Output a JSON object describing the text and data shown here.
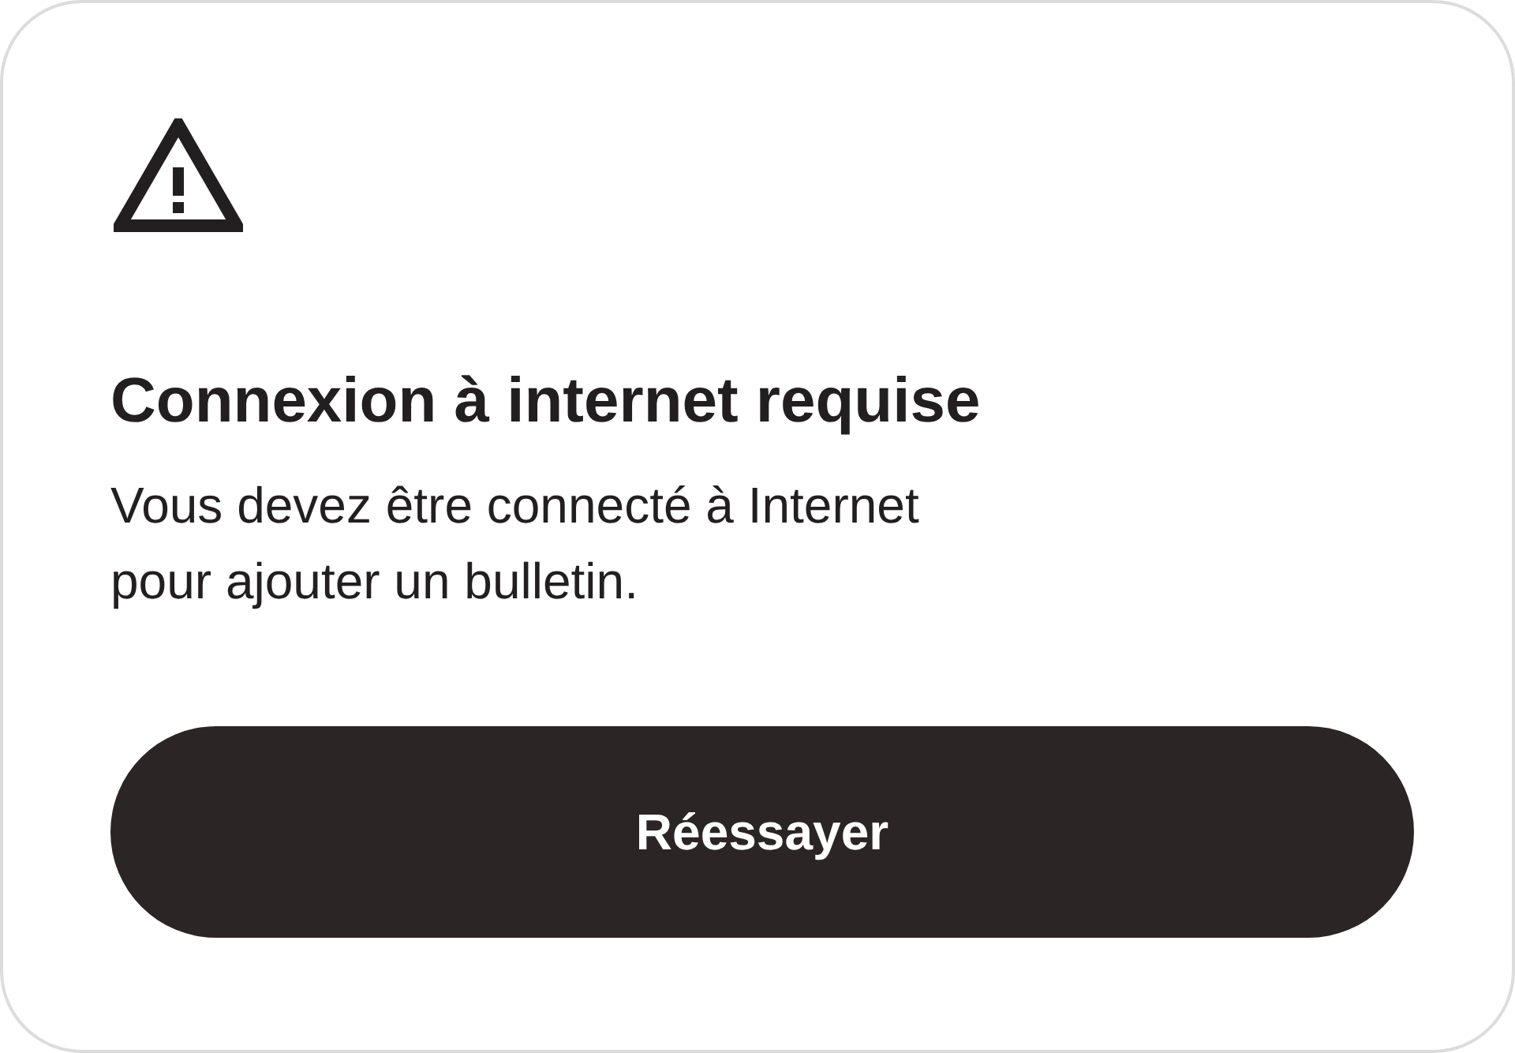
{
  "dialog": {
    "title": "Connexion à internet requise",
    "message": "Vous devez être connecté à Internet\npour ajouter un bulletin.",
    "button": "Réessayer"
  }
}
